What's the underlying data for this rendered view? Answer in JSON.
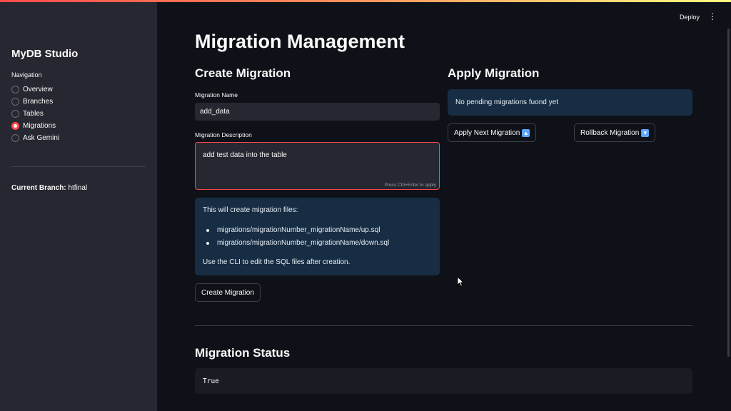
{
  "sidebar": {
    "title": "MyDB Studio",
    "nav_label": "Navigation",
    "items": [
      {
        "label": "Overview",
        "selected": false
      },
      {
        "label": "Branches",
        "selected": false
      },
      {
        "label": "Tables",
        "selected": false
      },
      {
        "label": "Migrations",
        "selected": true
      },
      {
        "label": "Ask Gemini",
        "selected": false
      }
    ],
    "current_branch_label": "Current Branch:",
    "current_branch_value": "htfinal"
  },
  "header": {
    "deploy_label": "Deploy",
    "menu_icon": "kebab-menu-icon"
  },
  "main": {
    "title": "Migration Management",
    "create": {
      "heading": "Create Migration",
      "name_label": "Migration Name",
      "name_value": "add_data",
      "description_label": "Migration Description",
      "description_value": "add test data into the table",
      "description_hint": "Press Ctrl+Enter to apply",
      "info_intro": "This will create migration files:",
      "info_files": [
        "migrations/migrationNumber_migrationName/up.sql",
        "migrations/migrationNumber_migrationName/down.sql"
      ],
      "info_note": "Use the CLI to edit the SQL files after creation.",
      "button_label": "Create Migration"
    },
    "apply": {
      "heading": "Apply Migration",
      "pending_message": "No pending migrations fuond yet",
      "apply_button_label": "Apply Next Migration",
      "rollback_button_label": "Rollback Migration"
    },
    "status": {
      "heading": "Migration Status",
      "value": "True"
    }
  },
  "colors": {
    "accent": "#ff4b4b",
    "sidebar_bg": "#262730",
    "main_bg": "#0e1117",
    "info_bg": "#172d43"
  }
}
